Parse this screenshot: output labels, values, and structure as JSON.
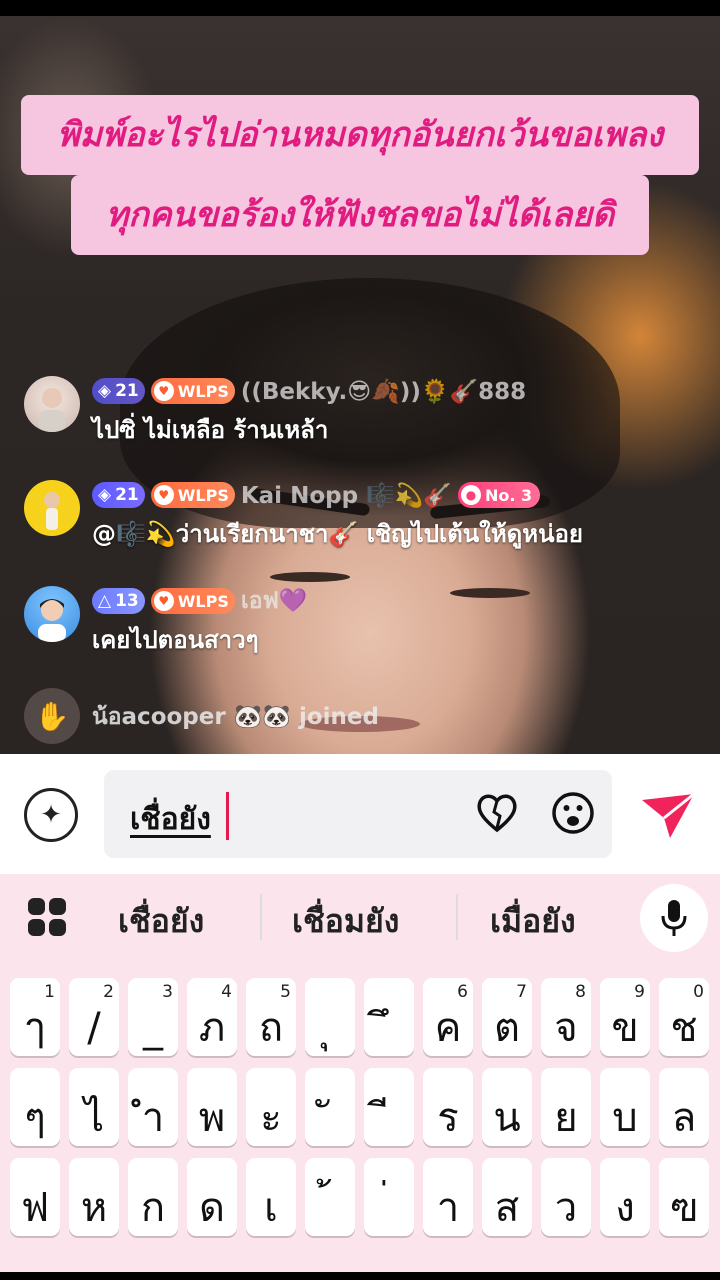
{
  "banner": {
    "line1": "พิมพ์อะไรไปอ่านหมดทุกอันยกเว้นขอเพลง",
    "line2": "ทุกคนขอร้องให้ฟังชลขอไม่ได้เลยดิ"
  },
  "chat": [
    {
      "level": "21",
      "fan_badge": "WLPS",
      "username": "((Bekky.😎🍂))🌻🎸888",
      "message": "ไปซิ่ ไม่เหลือ ร้านเหล้า"
    },
    {
      "level": "21",
      "fan_badge": "WLPS",
      "username": "Kai Nopp 🎼💫🎸",
      "rank_badge": "No. 3",
      "message": "@🎼💫ว่านเรียกนาชา🎸 เชิญไปเต้นให้ดูหน่อย"
    },
    {
      "level": "13",
      "fan_badge": "WLPS",
      "username": "เอฟ💜",
      "message": "เคยไปตอนสาวๆ"
    }
  ],
  "join_notice": {
    "text": "น้อacooper 🐼🐼 joined"
  },
  "input": {
    "value": "เชื่อยัง"
  },
  "keyboard": {
    "suggestions": [
      "เชื่อยัง",
      "เชื่อมยัง",
      "เมื่อยัง"
    ],
    "row1": [
      {
        "ch": "ๅ",
        "num": "1"
      },
      {
        "ch": "/",
        "num": "2"
      },
      {
        "ch": "_",
        "num": "3"
      },
      {
        "ch": "ภ",
        "num": "4"
      },
      {
        "ch": "ถ",
        "num": "5"
      },
      {
        "ch": "ุ",
        "num": ""
      },
      {
        "ch": "ึ",
        "num": ""
      },
      {
        "ch": "ค",
        "num": "6"
      },
      {
        "ch": "ต",
        "num": "7"
      },
      {
        "ch": "จ",
        "num": "8"
      },
      {
        "ch": "ข",
        "num": "9"
      },
      {
        "ch": "ช",
        "num": "0"
      }
    ],
    "row2": [
      "ๆ",
      "ไ",
      "ำ",
      "พ",
      "ะ",
      "ั",
      "ี",
      "ร",
      "น",
      "ย",
      "บ",
      "ล"
    ],
    "row3": [
      "ฟ",
      "ห",
      "ก",
      "ด",
      "เ",
      "้",
      "่",
      "า",
      "ส",
      "ว",
      "ง",
      "ฃ"
    ]
  },
  "colors": {
    "banner_bg": "#f6c5df",
    "banner_text": "#e11c80",
    "send": "#f0245a",
    "keyboard_bg": "#fbe4ec"
  }
}
